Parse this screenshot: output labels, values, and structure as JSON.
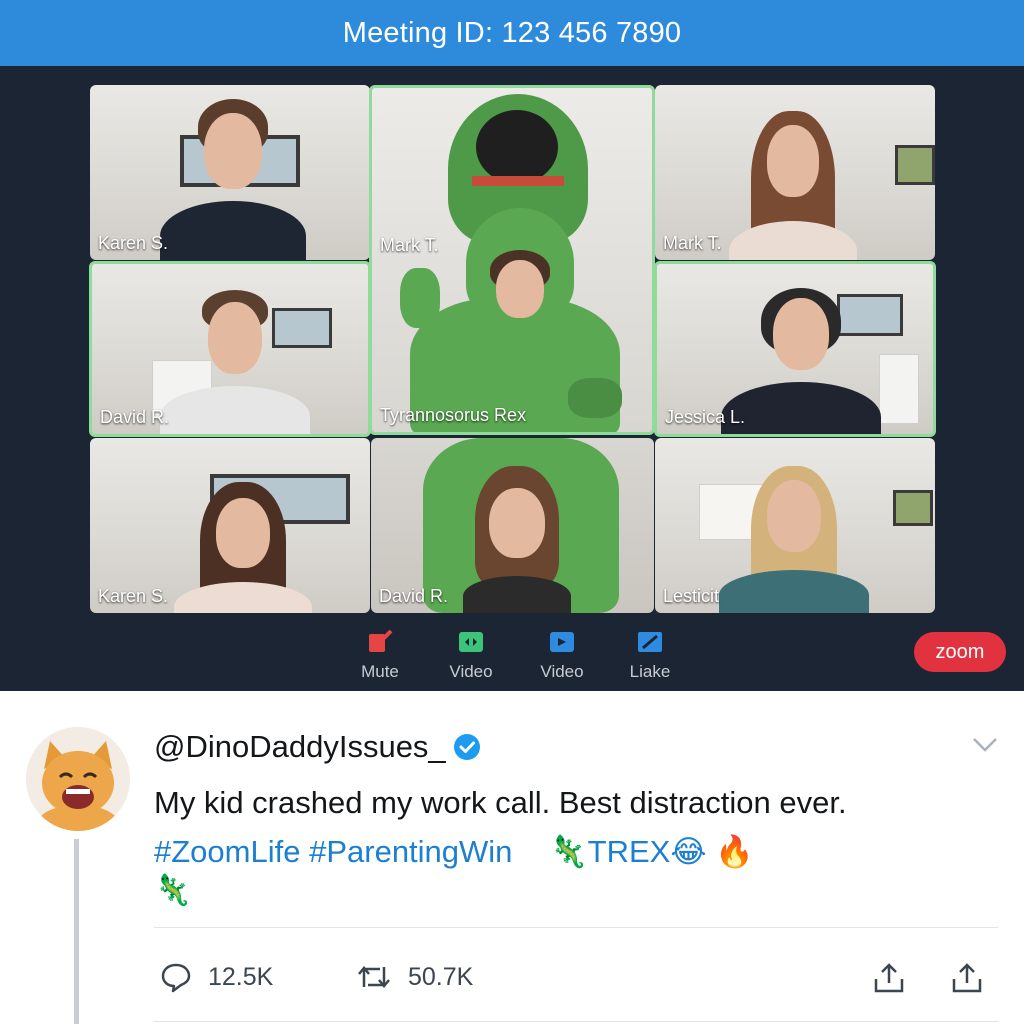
{
  "meeting": {
    "title": "Meeting ID: 123 456 7890",
    "participants": [
      {
        "name": "Karen S.",
        "active": false
      },
      {
        "name": "Mark T.",
        "active": true
      },
      {
        "name": "Mark T.",
        "active": false
      },
      {
        "name": "David R.",
        "active": true
      },
      {
        "name": "Tyrannosorus Rex",
        "active": true
      },
      {
        "name": "Jessica L.",
        "active": true
      },
      {
        "name": "Karen S.",
        "active": false
      },
      {
        "name": "David R.",
        "active": false
      },
      {
        "name": "Lesticit",
        "active": false
      }
    ],
    "toolbar": [
      {
        "label": "Mute",
        "icon": "mute-icon",
        "color": "#e64545"
      },
      {
        "label": "Video",
        "icon": "video-icon",
        "color": "#3cc47a"
      },
      {
        "label": "Video",
        "icon": "video-camera-icon",
        "color": "#2f8be0"
      },
      {
        "label": "Liake",
        "icon": "edit-icon",
        "color": "#2f8be0"
      }
    ],
    "brand_badge": "zoom"
  },
  "tweet": {
    "handle": "@DinoDaddyIssues_",
    "text": "My kid crashed my work call. Best distraction ever.",
    "hashtags": [
      "#ZoomLife",
      "#ParentingWin"
    ],
    "inline_tag": "🦎TREX😂 🔥",
    "extra_emoji": "🦎",
    "replies": "12.5K",
    "retweets": "50.7K"
  },
  "colors": {
    "header_blue": "#2e8bdc",
    "meeting_bg": "#1b2533",
    "active_border": "#8fdc9a",
    "zoom_red": "#e2323f",
    "link_blue": "#1d7fd1",
    "verified_blue": "#1d9bf0"
  }
}
